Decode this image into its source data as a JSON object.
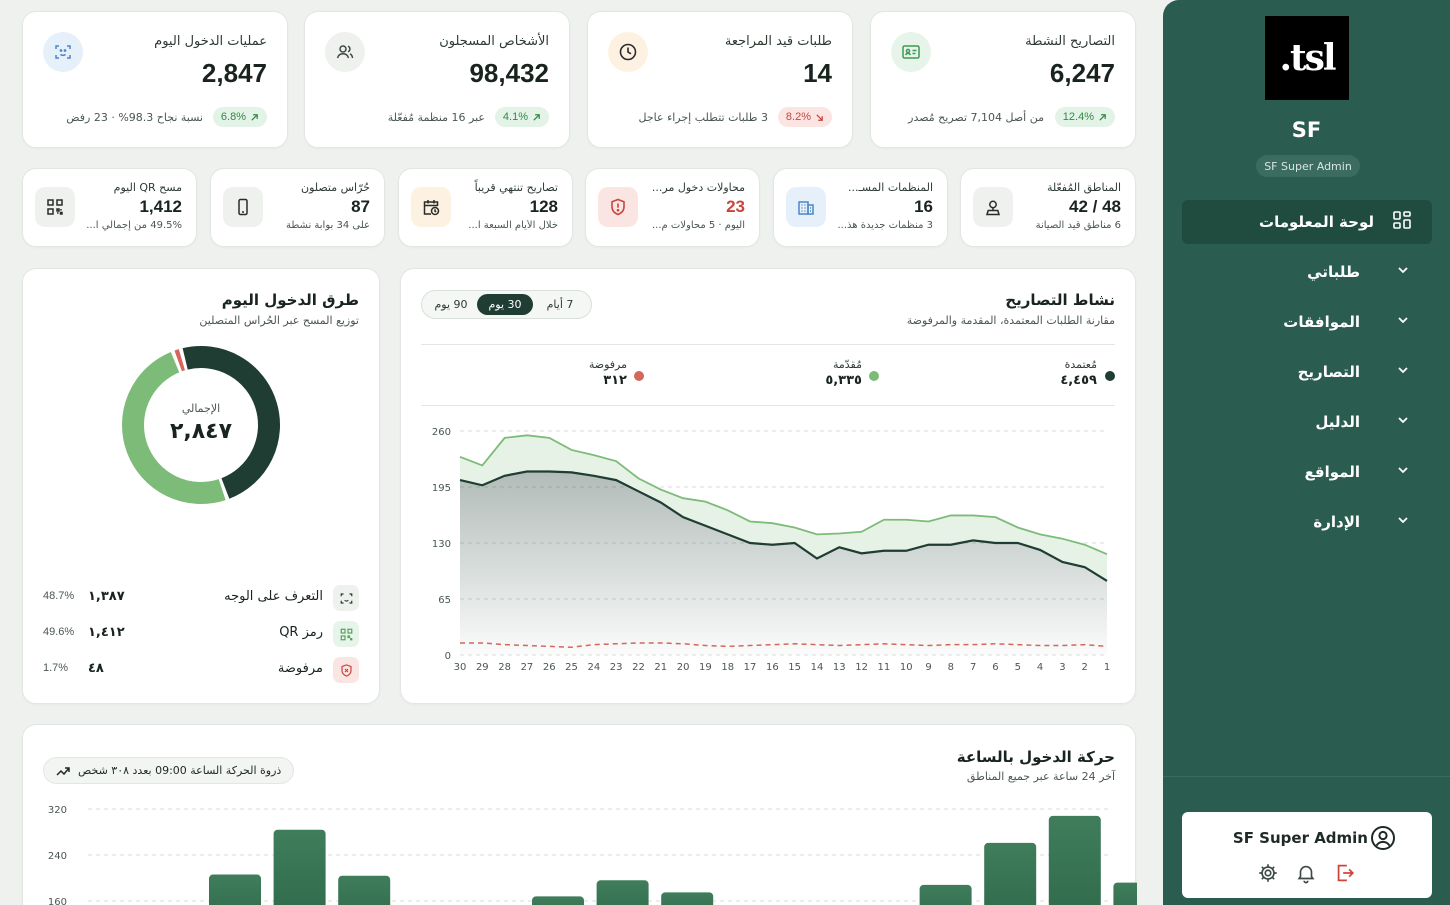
{
  "sidebar": {
    "logo_text": "tsl.",
    "org": "SF",
    "role": "SF Super Admin",
    "nav": [
      {
        "label": "لوحة المعلومات",
        "icon": "grid-icon",
        "active": true
      },
      {
        "label": "طلباتي",
        "icon": "chevron-down-icon"
      },
      {
        "label": "الموافقات",
        "icon": "chevron-down-icon"
      },
      {
        "label": "التصاريح",
        "icon": "chevron-down-icon"
      },
      {
        "label": "الدليل",
        "icon": "chevron-down-icon"
      },
      {
        "label": "المواقع",
        "icon": "chevron-down-icon"
      },
      {
        "label": "الإدارة",
        "icon": "chevron-down-icon"
      }
    ],
    "user": {
      "name": "SF Super Admin"
    }
  },
  "stats": [
    {
      "title": "التصاريح النشطة",
      "value": "6,247",
      "change": "12.4%",
      "trend": "up",
      "sub": "من أصل 7,104 تصريح مُصدر",
      "icon": "id-card-icon",
      "color": "#3f9a55",
      "bg": "#e7f4ea"
    },
    {
      "title": "طلبات قيد المراجعة",
      "value": "14",
      "change": "8.2%",
      "trend": "down",
      "sub": "3 طلبات تتطلب إجراء عاجل",
      "icon": "clock-icon",
      "color": "#b36a1c",
      "bg": "#fdf1e2"
    },
    {
      "title": "الأشخاص المسجلون",
      "value": "98,432",
      "change": "4.1%",
      "trend": "up",
      "sub": "عبر 16 منظمة مُفعّلة",
      "icon": "users-icon",
      "color": "#3d4a43",
      "bg": "#eef1ee"
    },
    {
      "title": "عمليات الدخول اليوم",
      "value": "2,847",
      "change": "6.8%",
      "trend": "up",
      "sub": "نسبة نجاح 98.3% · 23 رفض",
      "icon": "face-scan-icon",
      "color": "#4a86c5",
      "bg": "#e6f0fa"
    }
  ],
  "mini_stats": [
    {
      "title": "المناطق المُفعّلة",
      "value": "48 / 42",
      "sub": "6 مناطق قيد الصيانة",
      "icon": "user-pin-icon",
      "red": false,
      "color": "#3d4a43",
      "bg": "#eef1ee"
    },
    {
      "title": "المنظمات المسـ...",
      "value": "16",
      "sub": "3 منظمات جديدة هذ...",
      "icon": "building-icon",
      "red": false,
      "color": "#4a86c5",
      "bg": "#e6f0fa"
    },
    {
      "title": "محاولات دخول مر...",
      "value": "23",
      "sub": "اليوم · 5 محاولات م...",
      "icon": "shield-alert-icon",
      "red": true,
      "color": "#c6463d",
      "bg": "#fbe5e3"
    },
    {
      "title": "تصاريح تنتهي قريباً",
      "value": "128",
      "sub": "خلال الأيام السبعة ا...",
      "icon": "calendar-clock-icon",
      "red": false,
      "color": "#b36a1c",
      "bg": "#fdf1e2"
    },
    {
      "title": "حُرّاس متصلون",
      "value": "87",
      "sub": "على 34 بوابة نشطة",
      "icon": "device-icon",
      "red": false,
      "color": "#3d4a43",
      "bg": "#eef1ee"
    },
    {
      "title": "مسح QR اليوم",
      "value": "1,412",
      "sub": "49.5% من إجمالي ا...",
      "icon": "qr-icon",
      "red": false,
      "color": "#3d4a43",
      "bg": "#eef1ee"
    }
  ],
  "activity": {
    "title": "نشاط التصاريح",
    "subtitle": "مقارنة الطلبات المعتمدة، المقدمة والمرفوضة",
    "ranges": [
      "7 أيام",
      "30 يوم",
      "90 يوم"
    ],
    "selected_range": "30 يوم",
    "legend": [
      {
        "name": "مُعتمدة",
        "value": "٤,٤٥٩",
        "color": "#1f3d32"
      },
      {
        "name": "مُقدّمة",
        "value": "٥,٣٣٥",
        "color": "#7dbb78"
      },
      {
        "name": "مرفوضة",
        "value": "٣١٢",
        "color": "#d4675c"
      }
    ]
  },
  "methods": {
    "title": "طرق الدخول اليوم",
    "subtitle": "توزيع المسح عبر الحُراس المتصلين",
    "total_label": "الإجمالي",
    "total_value": "٢,٨٤٧",
    "items": [
      {
        "name": "التعرف على الوجه",
        "count": "١,٣٨٧",
        "pct": "48.7%",
        "icon": "face-scan-icon",
        "color": "#1f3d32",
        "bg": "#eef1ee",
        "value": 48.7
      },
      {
        "name": "رمز QR",
        "count": "١,٤١٢",
        "pct": "49.6%",
        "icon": "qr-icon",
        "color": "#7dbb78",
        "bg": "#e7f4ea",
        "value": 49.6
      },
      {
        "name": "مرفوضة",
        "count": "٤٨",
        "pct": "1.7%",
        "icon": "shield-alert-icon",
        "color": "#d4675c",
        "bg": "#fbe5e3",
        "value": 1.7
      }
    ]
  },
  "hourly": {
    "title": "حركة الدخول بالساعة",
    "subtitle": "آخر 24 ساعة عبر جميع المناطق",
    "peak_text": "ذروة الحركة الساعة 09:00 بعدد ٣٠٨ شخص"
  },
  "chart_data": [
    {
      "type": "area",
      "x": [
        30,
        29,
        28,
        27,
        26,
        25,
        24,
        23,
        22,
        21,
        20,
        19,
        18,
        17,
        16,
        15,
        14,
        13,
        12,
        11,
        10,
        9,
        8,
        7,
        6,
        5,
        4,
        3,
        2,
        1
      ],
      "x_tick_labels": [
        "30",
        "29",
        "28",
        "27",
        "26",
        "25",
        "24",
        "23",
        "22",
        "21",
        "20",
        "19",
        "18",
        "17",
        "16",
        "15",
        "14",
        "13",
        "12",
        "11",
        "10",
        "9",
        "8",
        "7",
        "6",
        "5",
        "4",
        "3",
        "2",
        "1"
      ],
      "y_ticks": [
        0,
        65,
        130,
        195,
        260
      ],
      "ylim": [
        0,
        260
      ],
      "series": [
        {
          "name": "مُقدّمة",
          "color": "#7dbb78",
          "values": [
            230,
            220,
            252,
            255,
            252,
            238,
            232,
            225,
            205,
            192,
            182,
            178,
            168,
            155,
            153,
            148,
            140,
            141,
            143,
            157,
            157,
            155,
            162,
            162,
            160,
            148,
            140,
            135,
            128,
            117
          ]
        },
        {
          "name": "مُعتمدة",
          "color": "#1f3d32",
          "values": [
            203,
            197,
            208,
            213,
            213,
            212,
            208,
            203,
            190,
            177,
            160,
            150,
            140,
            130,
            128,
            130,
            112,
            125,
            118,
            121,
            121,
            128,
            128,
            133,
            130,
            130,
            122,
            108,
            102,
            86
          ]
        },
        {
          "name": "مرفوضة",
          "color": "#d4675c",
          "values": [
            14,
            14,
            12,
            11,
            10,
            9,
            12,
            13,
            14,
            14,
            13,
            11,
            10,
            11,
            12,
            13,
            12,
            11,
            12,
            13,
            12,
            11,
            12,
            12,
            13,
            12,
            11,
            11,
            12,
            10
          ]
        }
      ]
    },
    {
      "type": "bar",
      "y_ticks": [
        160,
        240,
        320
      ],
      "values": [
        0,
        0,
        0,
        206,
        284,
        204,
        0,
        0,
        168,
        196,
        175,
        0,
        0,
        0,
        188,
        261,
        308,
        192,
        0,
        0,
        0,
        0,
        0,
        0
      ]
    }
  ]
}
